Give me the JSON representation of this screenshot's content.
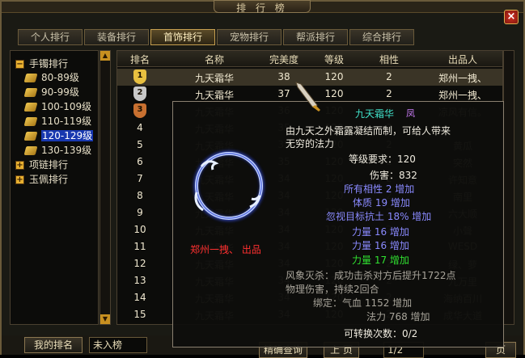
{
  "window": {
    "title": "排 行 榜",
    "close": "×"
  },
  "tabs": [
    {
      "label": "个人排行",
      "active": false
    },
    {
      "label": "装备排行",
      "active": false
    },
    {
      "label": "首饰排行",
      "active": true
    },
    {
      "label": "宠物排行",
      "active": false
    },
    {
      "label": "帮派排行",
      "active": false
    },
    {
      "label": "综合排行",
      "active": false
    }
  ],
  "tree": {
    "groups": [
      {
        "label": "手镯排行",
        "expander": "−"
      },
      {
        "label": "项链排行",
        "expander": "+"
      },
      {
        "label": "玉佩排行",
        "expander": "+"
      }
    ],
    "items": [
      "80-89级",
      "90-99级",
      "100-109级",
      "110-119级",
      "120-129级",
      "130-139级"
    ],
    "selected_index": 4
  },
  "table": {
    "headers": [
      "排名",
      "名称",
      "完美度",
      "等级",
      "相性",
      "出品人"
    ],
    "rows": [
      {
        "rank": "1",
        "name": "九天霜华",
        "perf": "38",
        "level": "120",
        "attr": "2",
        "maker": "郑州一拽、"
      },
      {
        "rank": "2",
        "name": "九天霜华",
        "perf": "37",
        "level": "120",
        "attr": "2",
        "maker": "郑州一拽、"
      },
      {
        "rank": "3",
        "name": "九天霜华",
        "perf": "36",
        "level": "120",
        "attr": "2",
        "maker": "凉风有信。"
      },
      {
        "rank": "4",
        "name": "九天霜华",
        "perf": "35",
        "level": "120",
        "attr": "2",
        "maker": ""
      },
      {
        "rank": "5",
        "name": "九天霜华",
        "perf": "35",
        "level": "120",
        "attr": "2",
        "maker": "黄瓜"
      },
      {
        "rank": "6",
        "name": "九天霜华",
        "perf": "35",
        "level": "120",
        "attr": "2",
        "maker": "突然"
      },
      {
        "rank": "7",
        "name": "九天霜华",
        "perf": "34",
        "level": "120",
        "attr": "2",
        "maker": "许知意"
      },
      {
        "rank": "8",
        "name": "九天霜华",
        "perf": "34",
        "level": "120",
        "attr": "2",
        "maker": "南里"
      },
      {
        "rank": "9",
        "name": "九天霜华",
        "perf": "34",
        "level": "120",
        "attr": "2",
        "maker": "六大顺"
      },
      {
        "rank": "10",
        "name": "九天霜华",
        "perf": "34",
        "level": "120",
        "attr": "2",
        "maker": "小聲"
      },
      {
        "rank": "11",
        "name": "九天霜华",
        "perf": "34",
        "level": "120",
        "attr": "2",
        "maker": "WESD"
      },
      {
        "rank": "12",
        "name": "九天霜华",
        "perf": "34",
        "level": "120",
        "attr": "2",
        "maker": "绿、萝"
      },
      {
        "rank": "13",
        "name": "九天霜华",
        "perf": "34",
        "level": "120",
        "attr": "2",
        "maker": "九万里"
      },
      {
        "rank": "14",
        "name": "九天霜华",
        "perf": "34",
        "level": "120",
        "attr": "2",
        "maker": "海纳百川"
      },
      {
        "rank": "15",
        "name": "九天霜华",
        "perf": "34",
        "level": "120",
        "attr": "2",
        "maker": "成华大道"
      }
    ],
    "scroll_up": "▲",
    "scroll_down": "▼"
  },
  "tooltip": {
    "name": "九天霜华",
    "tag": "凤",
    "desc1": "由九天之外霜露凝结而制，可给人带来",
    "desc2": "无穷的法力",
    "req": "等级要求：120",
    "damage": "伤害：832",
    "stat1": "所有相性 2 增加",
    "stat2": "体质 19 增加",
    "stat3": "忽视目标抗土 18% 增加",
    "stat4": "力量 16 增加",
    "stat5": "力量 16 增加",
    "stat6": "力量 17 增加",
    "maker": "郑州一拽、 出品",
    "skill1": "风象灭杀：成功击杀对方后提升1722点",
    "skill2": "物理伤害，持续2回合",
    "bind1": "绑定：气血 1152 增加",
    "bind2": "法力 768 增加",
    "convert": "可转换次数：0/2"
  },
  "bottom": {
    "my_rank_label": "我的排名",
    "my_rank_value": "未入榜",
    "search_label": "精确查询",
    "page_label": "上 页",
    "page_value": "1/2",
    "next_label": "页"
  },
  "colors": {
    "gold": "#e8b030",
    "select_blue": "#1838b0",
    "highlight_row": "#3a3426"
  }
}
